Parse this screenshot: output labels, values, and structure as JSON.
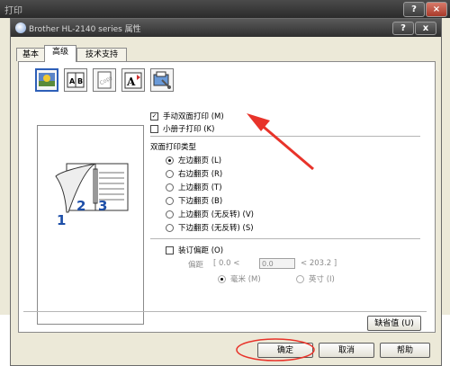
{
  "background_window": {
    "title": "打印",
    "help_button": "?",
    "close_button": "×"
  },
  "dialog": {
    "title": "Brother HL-2140 series 属性",
    "help_button": "?",
    "close_button": "x",
    "tabs": [
      {
        "label": "基本",
        "active": false
      },
      {
        "label": "高级",
        "active": true
      },
      {
        "label": "技术支持",
        "active": false
      }
    ],
    "toolbar_icons": [
      "print-quality-icon",
      "duplex-icon",
      "watermark-icon",
      "page-setting-icon",
      "device-options-icon"
    ],
    "toolbar_icon_text": {
      "duplex": "A|B",
      "watermark": "Copy",
      "page_setting": "A"
    },
    "preview_page_numbers": [
      "1",
      "2",
      "3"
    ],
    "options": {
      "manual_duplex": {
        "label": "手动双面打印 (M)",
        "checked": true
      },
      "booklet": {
        "label": "小册子打印 (K)",
        "checked": false
      }
    },
    "duplex_type": {
      "title": "双面打印类型",
      "items": [
        {
          "label": "左边翻页 (L)",
          "selected": true
        },
        {
          "label": "右边翻页 (R)",
          "selected": false
        },
        {
          "label": "上边翻页 (T)",
          "selected": false
        },
        {
          "label": "下边翻页 (B)",
          "selected": false
        },
        {
          "label": "上边翻页 (无反转) (V)",
          "selected": false
        },
        {
          "label": "下边翻页 (无反转) (S)",
          "selected": false
        }
      ]
    },
    "binding_offset": {
      "label": "装订偏距 (O)",
      "checked": false,
      "offset_label": "偏距",
      "range_min": "[ 0.0 <",
      "value": "0.0",
      "range_max": "< 203.2 ]",
      "units": [
        {
          "label": "毫米 (M)",
          "selected": true
        },
        {
          "label": "英寸 (I)",
          "selected": false
        }
      ]
    },
    "default_button": "缺省值 (U)",
    "ok_button": "确定",
    "cancel_button": "取消",
    "help_text_button": "帮助"
  },
  "annotations": {
    "arrow_color": "#e8332a",
    "highlight_color": "#e8332a"
  }
}
